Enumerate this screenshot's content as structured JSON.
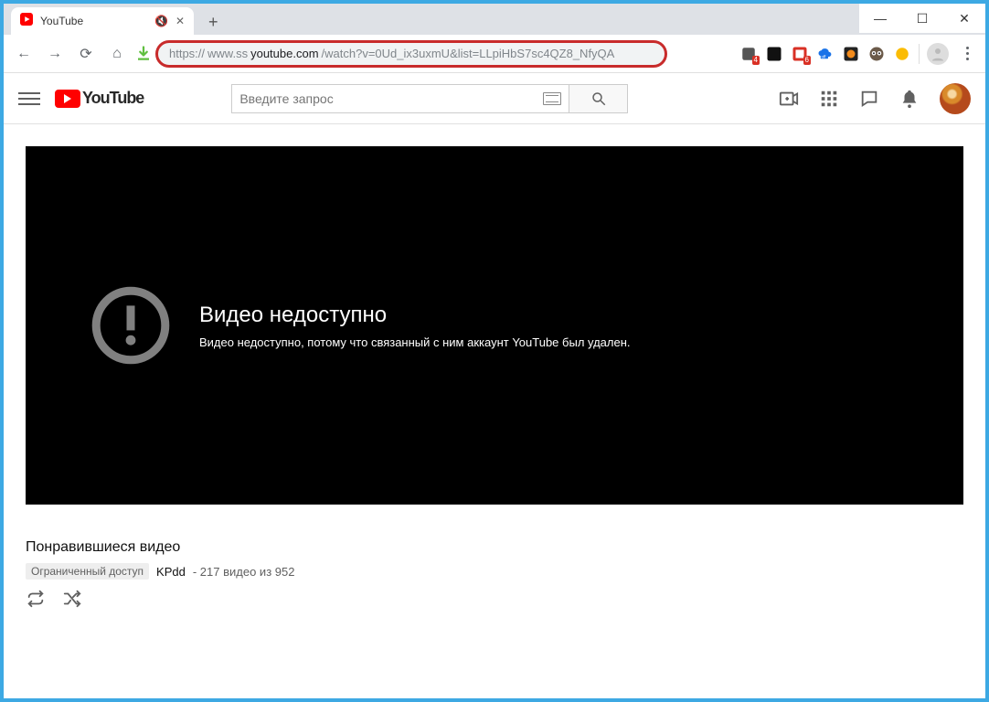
{
  "window": {
    "controls": [
      "minimize",
      "maximize",
      "close"
    ]
  },
  "browser": {
    "tab": {
      "title": "YouTube",
      "audio_muted": true
    },
    "url": {
      "scheme": "https://",
      "sub": "www.ss",
      "domain": "youtube.com",
      "path": "/watch?v=0Ud_ix3uxmU&list=LLpiHbS7sc4QZ8_NfyQA"
    },
    "extensions": [
      {
        "id": "ext-badge4",
        "badge": "4",
        "color": "#444"
      },
      {
        "id": "ext-dark",
        "color": "#111"
      },
      {
        "id": "ext-red6",
        "badge": "6",
        "color": "#d93025"
      },
      {
        "id": "ext-cloud-off",
        "color": "#1a73e8"
      },
      {
        "id": "ext-orange",
        "color": "#f28b1c"
      },
      {
        "id": "ext-owl",
        "color": "#5e4a3a"
      },
      {
        "id": "ext-yellow",
        "color": "#fbbc04"
      }
    ]
  },
  "youtube": {
    "logo_text": "YouTube",
    "search_placeholder": "Введите запрос",
    "header_icons": [
      "upload",
      "apps",
      "messages",
      "notifications"
    ],
    "player": {
      "error_title": "Видео недоступно",
      "error_body": "Видео недоступно, потому что связанный с ним аккаунт YouTube был удален."
    },
    "playlist": {
      "title": "Понравившиеся видео",
      "privacy_label": "Ограниченный доступ",
      "owner": "KPdd",
      "counter": "- 217 видео из 952",
      "icons": [
        "loop",
        "shuffle"
      ]
    }
  }
}
